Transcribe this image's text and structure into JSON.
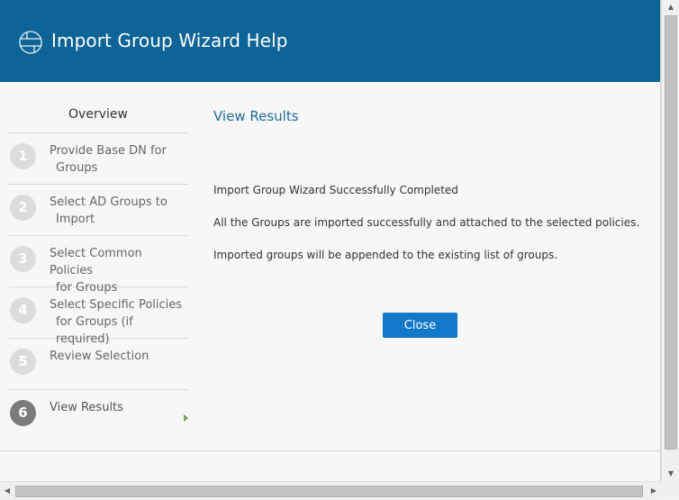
{
  "header": {
    "title": "Import Group Wizard Help",
    "logo_icon": "globe-icon",
    "background": "#0d6496"
  },
  "sidebar": {
    "overview_label": "Overview",
    "steps": [
      {
        "num": "1",
        "line1": "Provide Base DN for",
        "line2": "Groups"
      },
      {
        "num": "2",
        "line1": "Select AD Groups to",
        "line2": "Import"
      },
      {
        "num": "3",
        "line1": "Select Common Policies",
        "line2": "for Groups"
      },
      {
        "num": "4",
        "line1": "Select Specific Policies",
        "line2": "for Groups (if required)"
      },
      {
        "num": "5",
        "line1": "Review Selection",
        "line2": ""
      },
      {
        "num": "6",
        "line1": "View Results",
        "line2": "",
        "active": true
      }
    ]
  },
  "content": {
    "title": "View Results",
    "lines": [
      "Import Group Wizard Successfully Completed",
      "All the Groups are imported successfully and attached to the selected policies.",
      "Imported groups will be appended to the existing list of groups."
    ],
    "close_label": "Close"
  },
  "colors": {
    "accent": "#1478c8",
    "title_blue": "#1f6b9a",
    "active_arrow": "#6aa641"
  }
}
